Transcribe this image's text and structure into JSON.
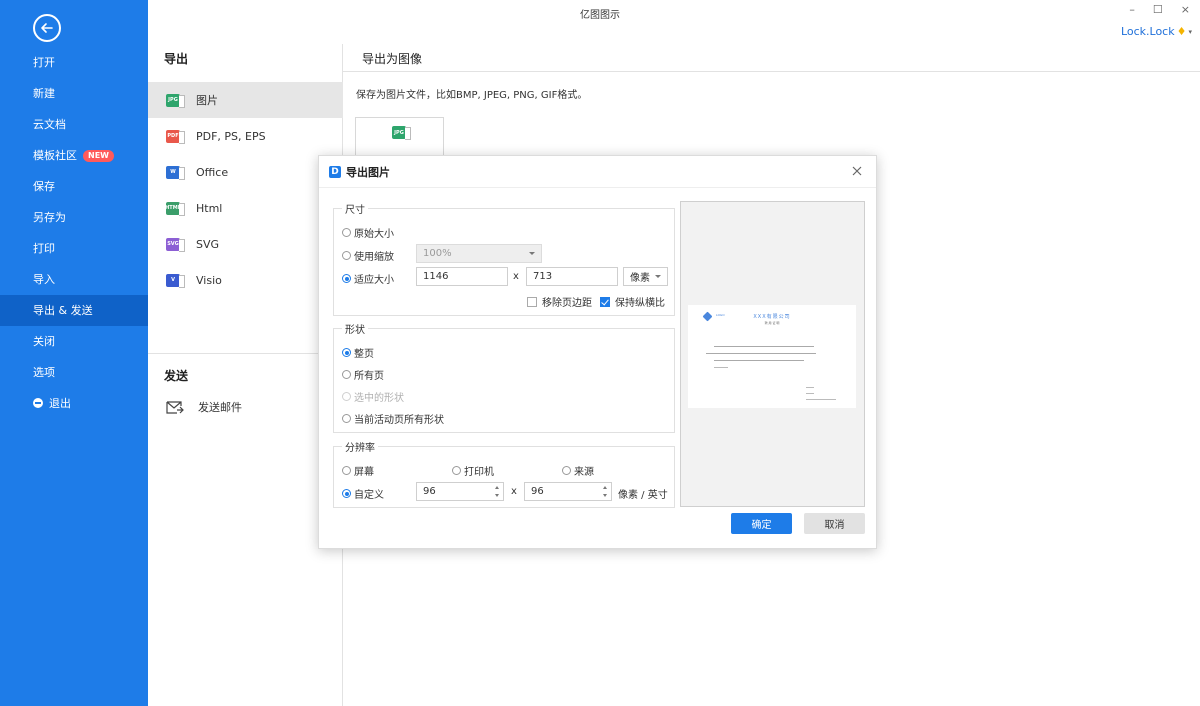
{
  "app": {
    "title": "亿图图示",
    "user": "Lock.Lock"
  },
  "window": {
    "minimize": "–",
    "maximize": "☐",
    "close": "×"
  },
  "sidebar": {
    "items": [
      {
        "label": "打开"
      },
      {
        "label": "新建"
      },
      {
        "label": "云文档"
      },
      {
        "label": "模板社区",
        "badge": "NEW"
      },
      {
        "label": "保存"
      },
      {
        "label": "另存为"
      },
      {
        "label": "打印"
      },
      {
        "label": "导入"
      },
      {
        "label": "导出 & 发送",
        "active": true
      },
      {
        "label": "关闭"
      },
      {
        "label": "选项"
      },
      {
        "label": "退出"
      }
    ]
  },
  "export_panel": {
    "heading": "导出",
    "items": [
      {
        "label": "图片",
        "icon": "JPG"
      },
      {
        "label": "PDF, PS, EPS",
        "icon": "PDF"
      },
      {
        "label": "Office",
        "icon": "W"
      },
      {
        "label": "Html",
        "icon": "HTML"
      },
      {
        "label": "SVG",
        "icon": "SVG"
      },
      {
        "label": "Visio",
        "icon": "V"
      }
    ],
    "send_heading": "发送",
    "send_items": [
      {
        "label": "发送邮件"
      }
    ]
  },
  "right_panel": {
    "heading": "导出为图像",
    "description": "保存为图片文件，比如BMP, JPEG, PNG, GIF格式。",
    "card_icon": "JPG"
  },
  "dialog": {
    "title": "导出图片",
    "size_group": {
      "title": "尺寸",
      "original": "原始大小",
      "use_zoom": "使用缩放",
      "zoom_value": "100%",
      "fit": "适应大小",
      "width": "1146",
      "height": "713",
      "x": "x",
      "unit": "像素",
      "remove_margin": "移除页边距",
      "keep_ratio": "保持纵横比"
    },
    "shape_group": {
      "title": "形状",
      "whole_page": "整页",
      "all_pages": "所有页",
      "selected": "选中的形状",
      "current_page": "当前活动页所有形状"
    },
    "resolution_group": {
      "title": "分辨率",
      "screen": "屏幕",
      "printer": "打印机",
      "source": "来源",
      "custom": "自定义",
      "dpi_x": "96",
      "dpi_y": "96",
      "x": "x",
      "unit": "像素 / 英寸"
    },
    "preview": {
      "logo_text": "LOGO",
      "doc_title": "XXX有限公司",
      "doc_subtitle": "聘 用 证 明"
    },
    "ok": "确定",
    "cancel": "取消"
  }
}
